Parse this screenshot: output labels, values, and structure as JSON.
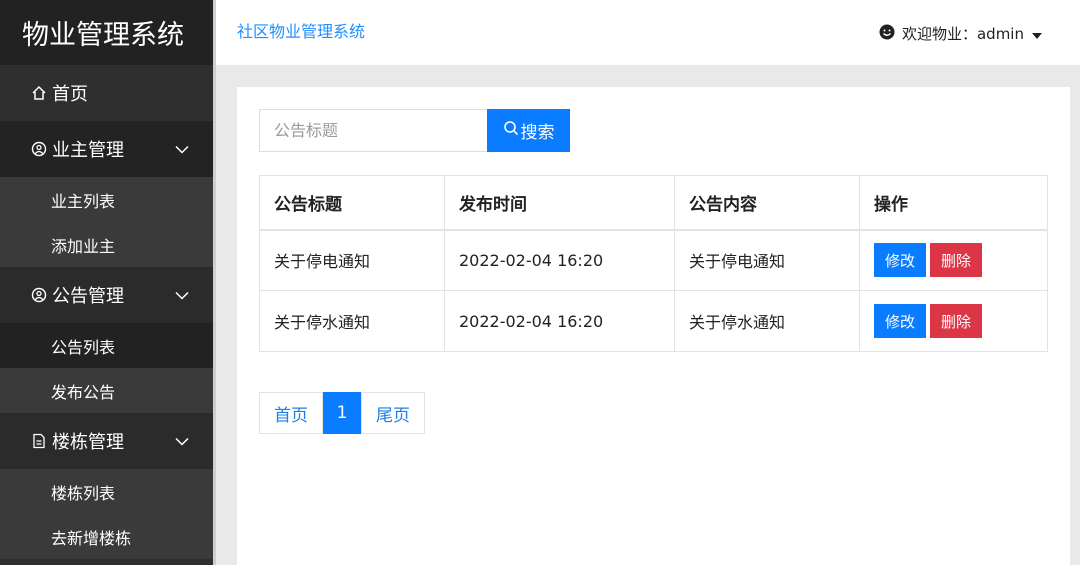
{
  "sidebar": {
    "brand": "物业管理系统",
    "home": {
      "label": "首页",
      "icon": "home-icon"
    },
    "groups": [
      {
        "label": "业主管理",
        "icon": "user-circle-icon",
        "items": [
          "业主列表",
          "添加业主"
        ]
      },
      {
        "label": "公告管理",
        "icon": "user-circle-icon",
        "items": [
          "公告列表",
          "发布公告"
        ]
      },
      {
        "label": "楼栋管理",
        "icon": "document-icon",
        "items": [
          "楼栋列表",
          "去新增楼栋"
        ]
      }
    ]
  },
  "header": {
    "title": "社区物业管理系统",
    "user": "欢迎物业：admin"
  },
  "search": {
    "placeholder": "公告标题",
    "button_label": "搜索"
  },
  "table": {
    "columns": [
      "公告标题",
      "发布时间",
      "公告内容",
      "操作"
    ],
    "rows": [
      {
        "title": "关于停电通知",
        "time": "2022-02-04 16:20",
        "content": "关于停电通知",
        "edit": "修改",
        "delete": "删除"
      },
      {
        "title": "关于停水通知",
        "time": "2022-02-04 16:20",
        "content": "关于停水通知",
        "edit": "修改",
        "delete": "删除"
      }
    ]
  },
  "pager": {
    "first": "首页",
    "current": "1",
    "last": "尾页"
  },
  "colors": {
    "primary": "#0a7cff",
    "danger": "#dc3545",
    "sidebar": "#2f2f2f"
  }
}
